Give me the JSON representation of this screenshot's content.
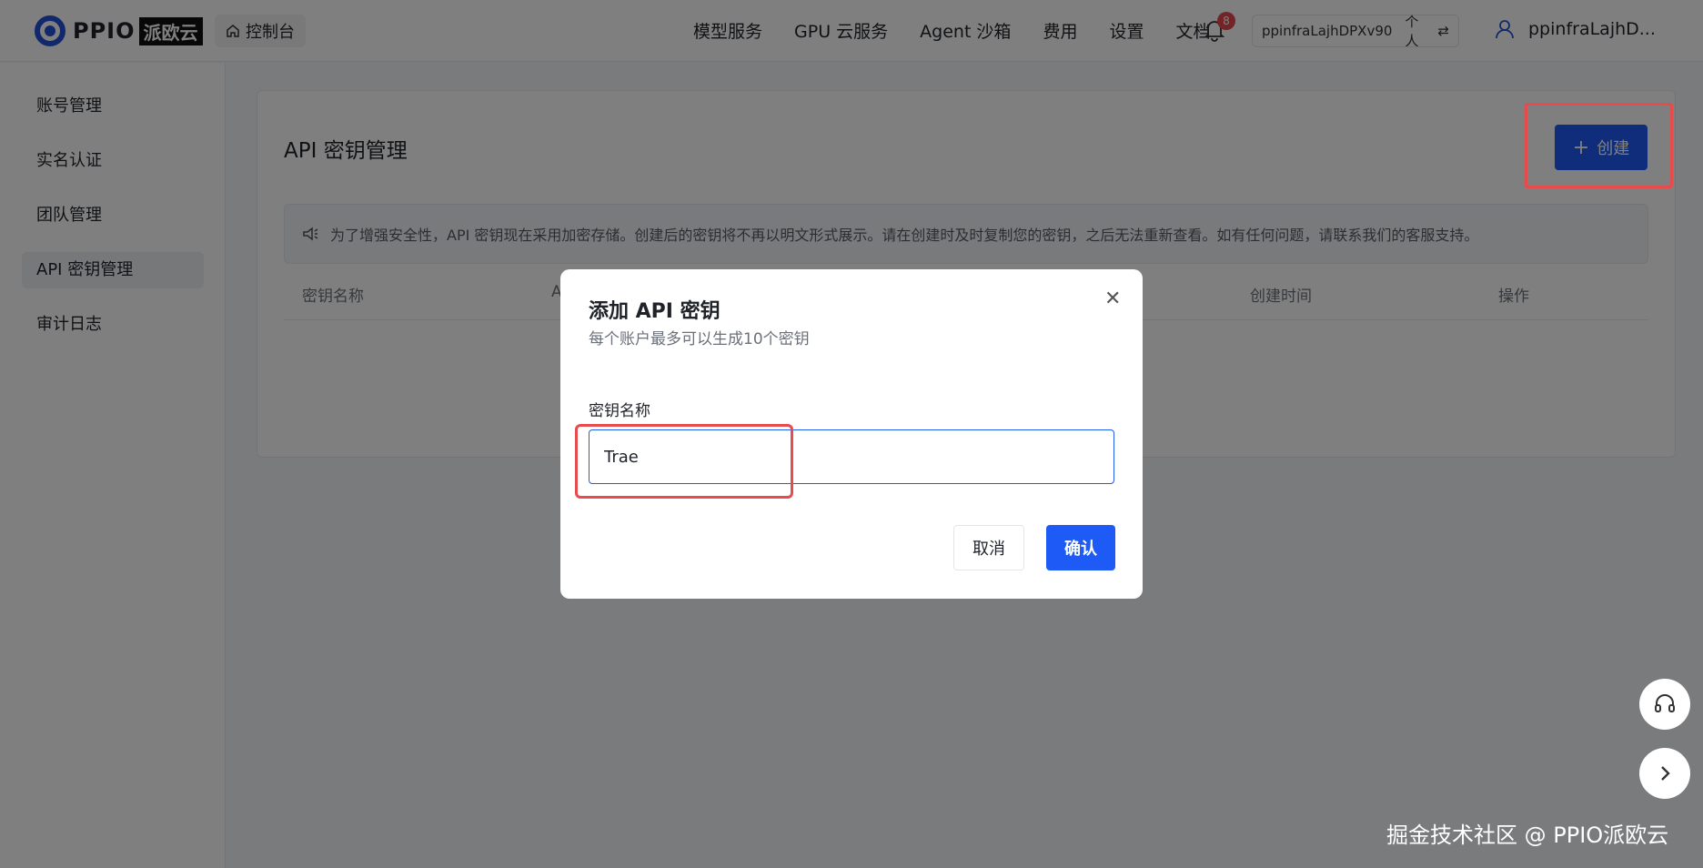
{
  "header": {
    "logo_text": "PPIO",
    "logo_badge": "派欧云",
    "console_label": "控制台",
    "nav": [
      "模型服务",
      "GPU 云服务",
      "Agent 沙箱",
      "费用",
      "设置",
      "文档"
    ],
    "notification_count": "8",
    "account_id": "ppinfraLajhDPXv90",
    "account_type": "个人",
    "user_name": "ppinfraLajhD..."
  },
  "sidebar": {
    "items": [
      {
        "label": "账号管理"
      },
      {
        "label": "实名认证"
      },
      {
        "label": "团队管理"
      },
      {
        "label": "API 密钥管理"
      },
      {
        "label": "审计日志"
      }
    ],
    "active_index": 3
  },
  "main": {
    "title": "API 密钥管理",
    "create_label": "创建",
    "notice": "为了增强安全性，API 密钥现在采用加密存储。创建后的密钥将不再以明文形式展示。请在创建时及时复制您的密钥，之后无法重新查看。如有任何问题，请联系我们的客服支持。",
    "columns": [
      "密钥名称",
      "A",
      "创建时间",
      "操作"
    ]
  },
  "modal": {
    "title": "添加 API 密钥",
    "subtitle": "每个账户最多可以生成10个密钥",
    "field_label": "密钥名称",
    "field_value": "Trae",
    "cancel_label": "取消",
    "confirm_label": "确认"
  },
  "watermark": "掘金技术社区 @ PPIO派欧云",
  "colors": {
    "primary": "#1e5bf6",
    "highlight": "#e84b4b",
    "badge": "#e5484d"
  }
}
